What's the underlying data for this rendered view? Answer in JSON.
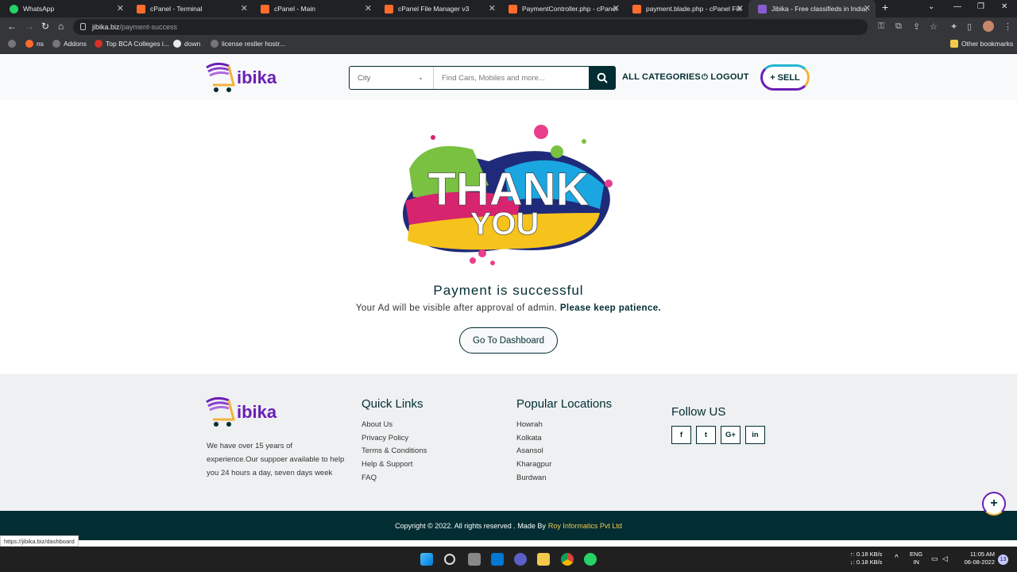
{
  "browser": {
    "tabs": [
      {
        "label": "WhatsApp",
        "color": "#25d366"
      },
      {
        "label": "cPanel - Terminal",
        "color": "#ff6c2c"
      },
      {
        "label": "cPanel - Main",
        "color": "#ff6c2c"
      },
      {
        "label": "cPanel File Manager v3",
        "color": "#ff6c2c"
      },
      {
        "label": "PaymentController.php - cPanel",
        "color": "#ff6c2c"
      },
      {
        "label": "payment.blade.php - cPanel File",
        "color": "#ff6c2c"
      },
      {
        "label": "Jibika - Free classifieds in India,",
        "color": "#8a5cd1"
      }
    ],
    "url_domain": "jibika.biz",
    "url_path": "/payment-success",
    "bookmarks": [
      "ns",
      "Addons",
      "Top BCA Colleges i...",
      "down",
      "license resller hostr..."
    ],
    "other_bookmarks": "Other bookmarks",
    "status_url": "https://jibika.biz/dashboard"
  },
  "site": {
    "logo_text": "ibika",
    "search": {
      "city_placeholder": "City",
      "query_placeholder": "Find Cars, Mobiles and more..."
    },
    "nav": {
      "categories": "ALL CATEGORIES",
      "logout": "LOGOUT",
      "sell": "SELL"
    },
    "thank_line1": "THANK",
    "thank_line2": "YOU",
    "headline": "Payment is successful",
    "message": "Your Ad will be visible after approval of admin.",
    "message_bold": "Please keep patience.",
    "dashboard_button": "Go To Dashboard",
    "footer": {
      "about": "We have over 15 years of experience.Our suppoer available to help you 24 hours a day, seven days week",
      "quick_links_title": "Quick Links",
      "quick_links": [
        "About Us",
        "Privacy Policy",
        "Terms & Conditions",
        "Help & Support",
        "FAQ"
      ],
      "locations_title": "Popular Locations",
      "locations": [
        "Howrah",
        "Kolkata",
        "Asansol",
        "Kharagpur",
        "Burdwan"
      ],
      "follow_title": "Follow US",
      "social": [
        "f",
        "t",
        "G+",
        "in"
      ],
      "copyright": "Copyright © 2022. All rights reserved . Made By",
      "company": "Roy Informatics Pvt Ltd"
    }
  },
  "taskbar": {
    "net_up": "↑: 0.18 KB/s",
    "net_down": "↓: 0.18 KB/s",
    "lang": "ENG",
    "region": "IN",
    "time": "11:05 AM",
    "date": "06-08-2022",
    "notifications": "13"
  }
}
